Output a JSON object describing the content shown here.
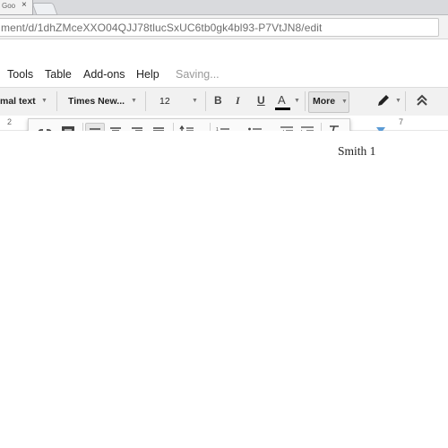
{
  "browser": {
    "tab_label": "Goo",
    "url": "ment/d/1dhZMceXXO04QJJ78tlucSxUC6tb0gk4bl93-P7VtJN8/edit"
  },
  "menu": {
    "items": [
      "Tools",
      "Table",
      "Add-ons",
      "Help"
    ],
    "status": "Saving..."
  },
  "toolbar": {
    "style": "mal text",
    "font": "Times New...",
    "size": "12",
    "bold": "B",
    "italic": "I",
    "underline": "U",
    "text_color": "A",
    "more": "More",
    "text_color_swatch": "#000000"
  },
  "ruler": {
    "left_number": "2",
    "right_number": "7"
  },
  "document": {
    "header_text": "Smith 1"
  }
}
